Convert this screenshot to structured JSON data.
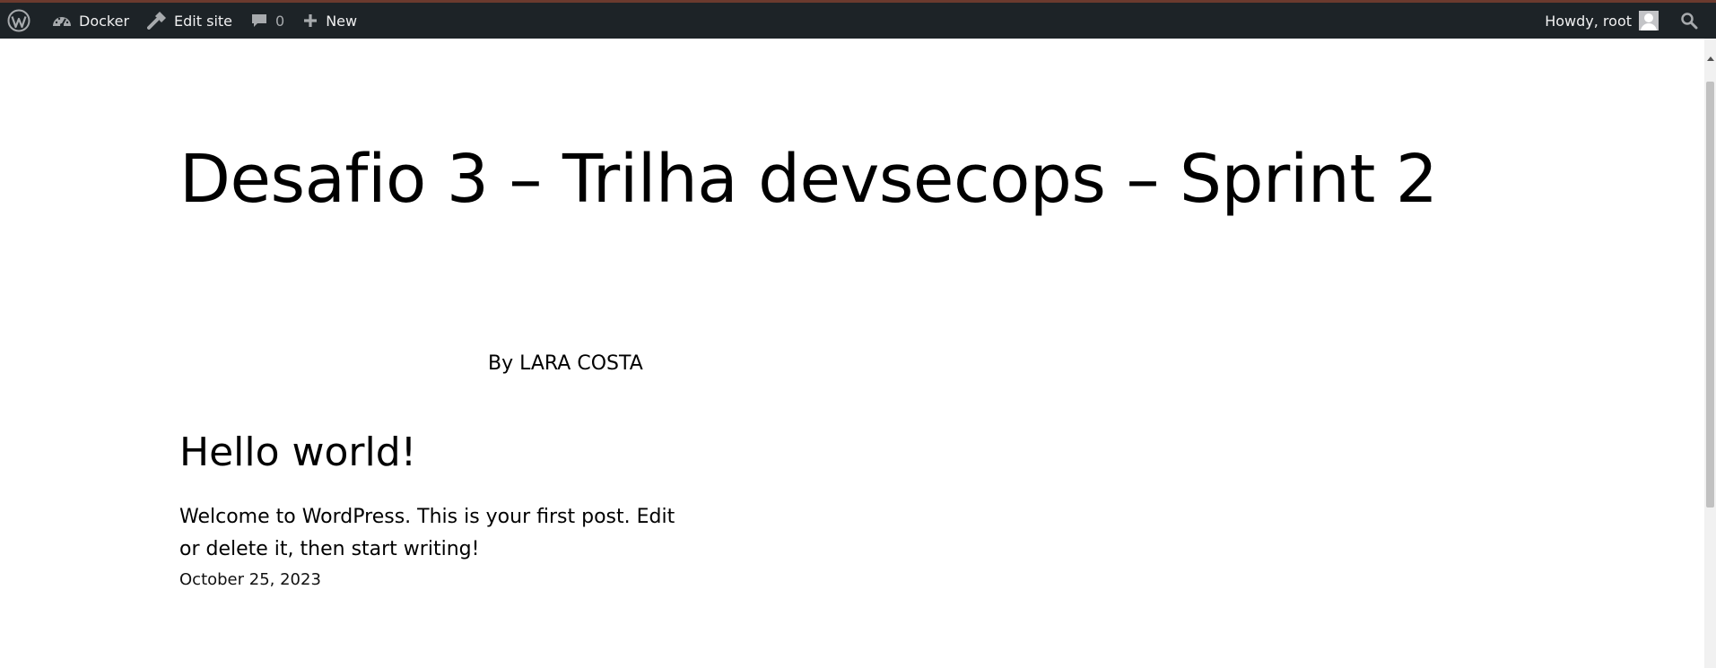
{
  "admin_bar": {
    "site_name": "Docker",
    "edit_site": "Edit site",
    "comments_count": "0",
    "new_label": "New",
    "howdy": "Howdy, root"
  },
  "site": {
    "title": "Desafio 3 – Trilha devsecops – Sprint 2",
    "byline": "By LARA COSTA"
  },
  "post": {
    "title": "Hello world!",
    "excerpt": "Welcome to WordPress. This is your first post. Edit or delete it, then start writing!",
    "date": "October 25, 2023"
  },
  "icons": {
    "wordpress": "wordpress-logo-icon",
    "dashboard": "dashboard-gauge-icon",
    "edit": "hammer-brush-icon",
    "comments": "speech-bubble-icon",
    "new": "plus-icon",
    "avatar": "user-avatar-icon",
    "search": "magnifier-icon"
  },
  "colors": {
    "admin_bar_bg": "#1d2327",
    "admin_bar_text": "#f0f0f1",
    "admin_bar_border": "#6b3a2e",
    "page_bg": "#ffffff",
    "text": "#000000"
  }
}
